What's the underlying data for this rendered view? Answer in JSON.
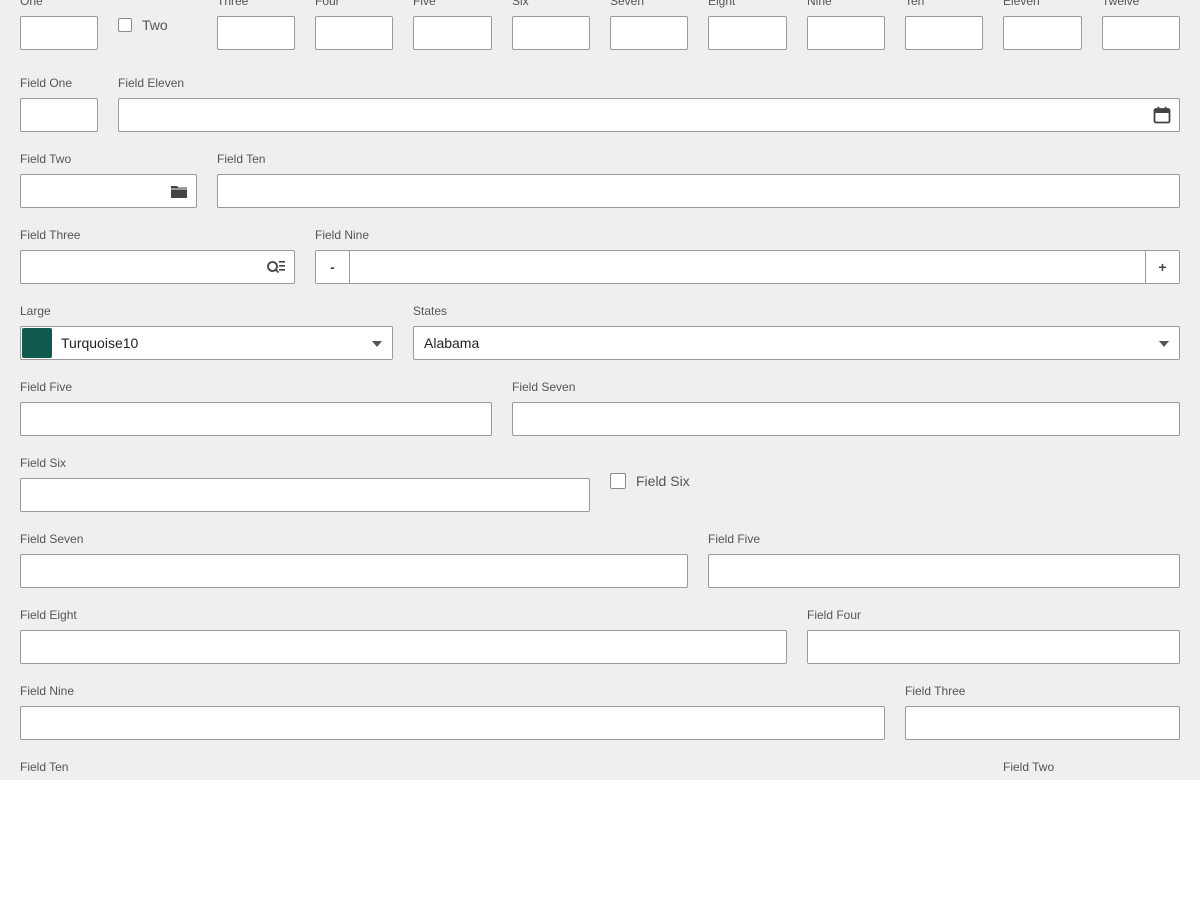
{
  "row1": {
    "one": {
      "label": "One",
      "value": ""
    },
    "two": {
      "label": "Two",
      "checked": false
    },
    "three": {
      "label": "Three",
      "value": ""
    },
    "four": {
      "label": "Four",
      "value": ""
    },
    "five": {
      "label": "Five",
      "value": ""
    },
    "six": {
      "label": "Six",
      "value": ""
    },
    "seven": {
      "label": "Seven",
      "value": ""
    },
    "eight": {
      "label": "Eight",
      "value": ""
    },
    "nine": {
      "label": "Nine",
      "value": ""
    },
    "ten": {
      "label": "Ten",
      "value": ""
    },
    "eleven": {
      "label": "Eleven",
      "value": ""
    },
    "twelve": {
      "label": "Twelve",
      "value": ""
    }
  },
  "row2": {
    "field_one": {
      "label": "Field One",
      "value": ""
    },
    "field_eleven": {
      "label": "Field Eleven",
      "value": "",
      "icon": "calendar-icon"
    }
  },
  "row3": {
    "field_two": {
      "label": "Field Two",
      "value": "",
      "icon": "folder-icon"
    },
    "field_ten": {
      "label": "Field Ten",
      "value": ""
    }
  },
  "row4": {
    "field_three": {
      "label": "Field Three",
      "value": "",
      "icon": "search-list-icon"
    },
    "field_nine": {
      "label": "Field Nine",
      "value": "",
      "decrement": "-",
      "increment": "+"
    }
  },
  "row5": {
    "large": {
      "label": "Large",
      "selected": "Turquoise10",
      "swatch_color": "#0e5a4e"
    },
    "states": {
      "label": "States",
      "selected": "Alabama"
    }
  },
  "row6": {
    "field_five": {
      "label": "Field Five",
      "value": ""
    },
    "field_seven": {
      "label": "Field Seven",
      "value": ""
    }
  },
  "row7": {
    "field_six": {
      "label": "Field Six",
      "value": ""
    },
    "field_six_check": {
      "label": "Field Six",
      "checked": false
    }
  },
  "row8": {
    "field_seven": {
      "label": "Field Seven",
      "value": ""
    },
    "field_five": {
      "label": "Field Five",
      "value": ""
    }
  },
  "row9": {
    "field_eight": {
      "label": "Field Eight",
      "value": ""
    },
    "field_four": {
      "label": "Field Four",
      "value": ""
    }
  },
  "row10": {
    "field_nine": {
      "label": "Field Nine",
      "value": ""
    },
    "field_three": {
      "label": "Field Three",
      "value": ""
    }
  },
  "row11": {
    "field_ten": {
      "label": "Field Ten"
    },
    "field_two": {
      "label": "Field Two"
    }
  },
  "colors": {
    "background": "#efefef",
    "border": "#9a9a9a",
    "label": "#555555"
  }
}
